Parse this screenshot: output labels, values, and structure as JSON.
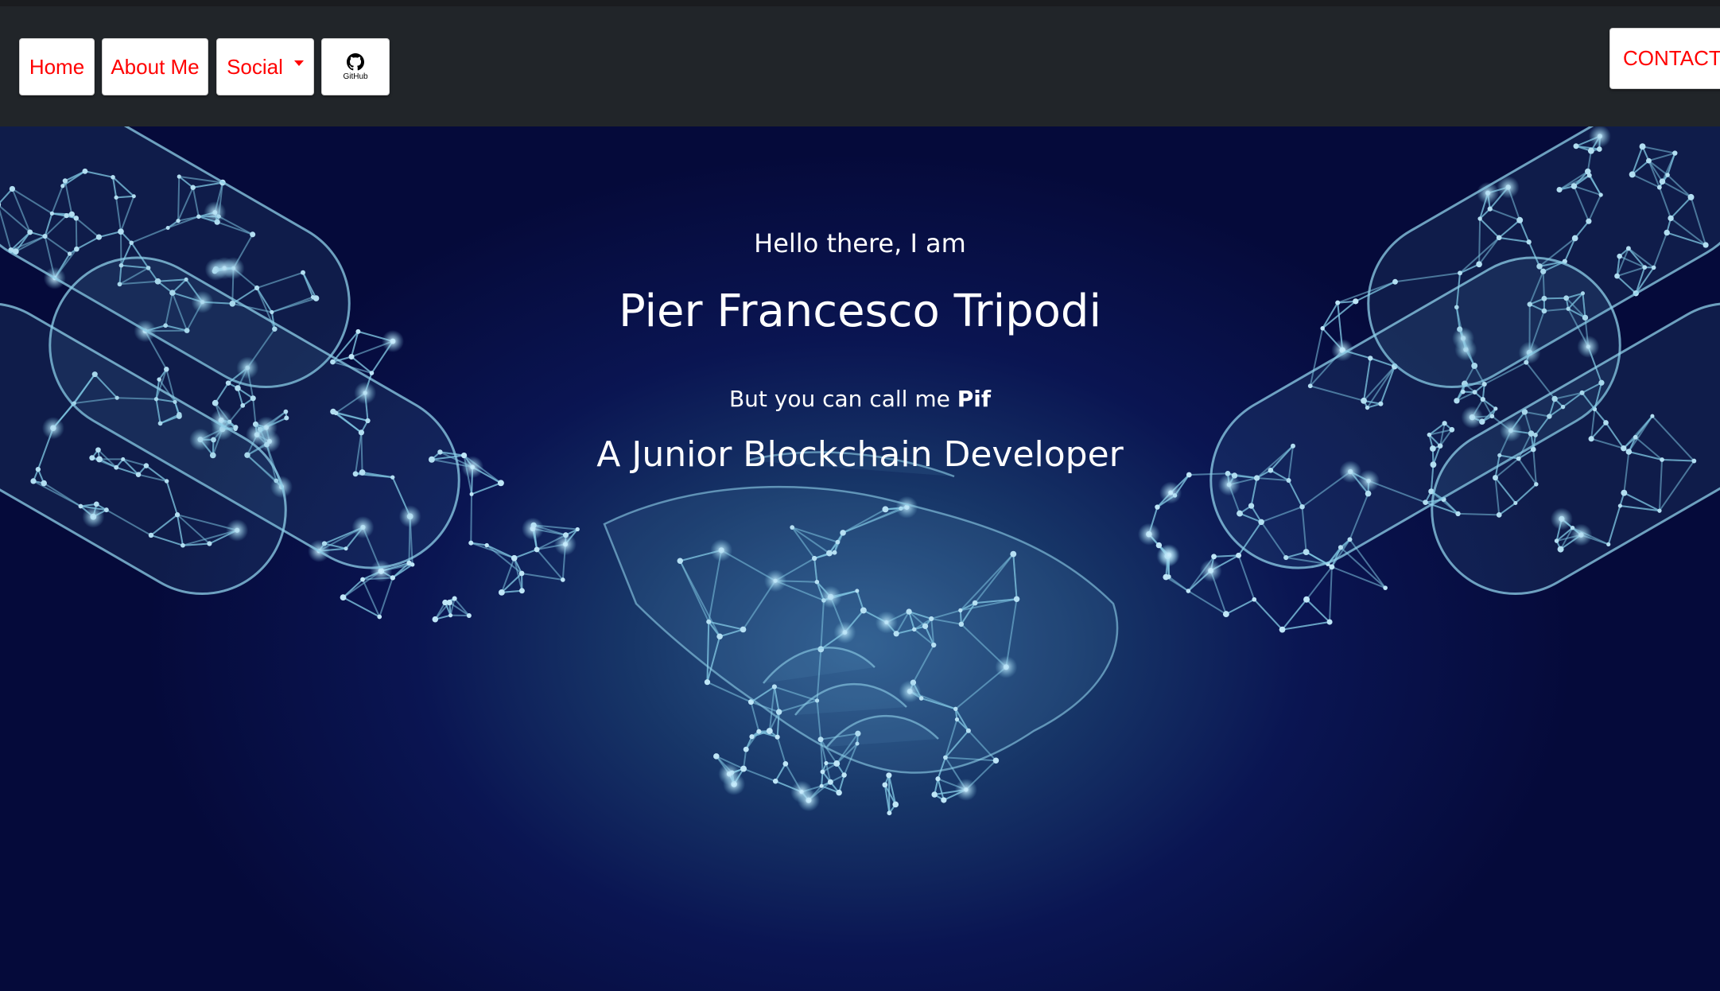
{
  "navbar": {
    "home_label": "Home",
    "about_label": "About Me",
    "social_label": "Social",
    "github_label": "GitHub",
    "contact_label": "CONTACT"
  },
  "hero": {
    "greeting": "Hello there, I am",
    "name": "Pier Francesco Tripodi",
    "nickname_prefix": "But you can call me ",
    "nickname": "Pif",
    "role": "A Junior Blockchain Developer"
  },
  "colors": {
    "navbar_bg": "#212529",
    "button_text": "#ff0000",
    "hero_bg": "#050a3a",
    "network_lines": "#7fc4e0"
  },
  "icons": {
    "github": "github-icon",
    "dropdown": "caret-down-icon"
  }
}
